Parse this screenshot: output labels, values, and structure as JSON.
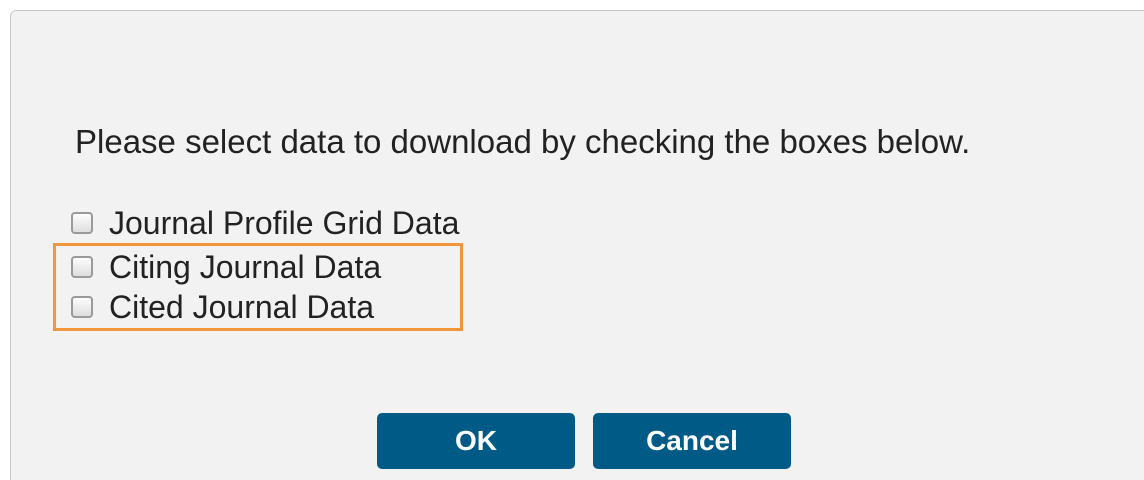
{
  "dialog": {
    "prompt": "Please select data to download by checking the boxes below.",
    "options": [
      {
        "label": "Journal Profile Grid Data",
        "checked": false
      },
      {
        "label": "Citing Journal Data",
        "checked": false
      },
      {
        "label": "Cited Journal Data",
        "checked": false
      }
    ],
    "highlight_color": "#f0963c",
    "buttons": {
      "ok_label": "OK",
      "cancel_label": "Cancel",
      "button_color": "#005a86"
    }
  }
}
